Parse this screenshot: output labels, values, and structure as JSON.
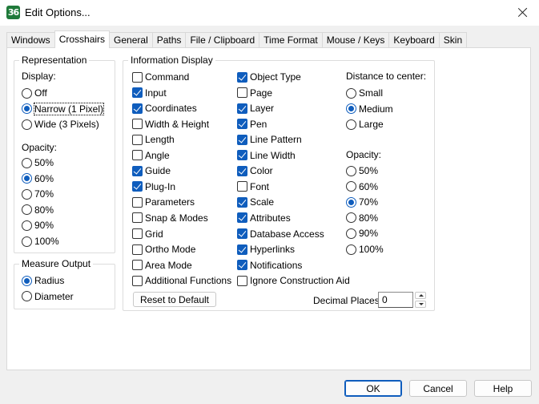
{
  "window": {
    "app_icon_text": "36",
    "title": "Edit Options..."
  },
  "tabs": [
    "Windows",
    "Crosshairs",
    "General",
    "Paths",
    "File / Clipboard",
    "Time Format",
    "Mouse / Keys",
    "Keyboard",
    "Skin"
  ],
  "active_tab": "Crosshairs",
  "representation": {
    "legend": "Representation",
    "display_label": "Display:",
    "display_options": [
      {
        "label": "Off",
        "selected": false
      },
      {
        "label": "Narrow (1 Pixel)",
        "selected": true
      },
      {
        "label": "Wide (3 Pixels)",
        "selected": false
      }
    ],
    "opacity_label": "Opacity:",
    "opacity_options": [
      {
        "label": "50%",
        "selected": false
      },
      {
        "label": "60%",
        "selected": true
      },
      {
        "label": "70%",
        "selected": false
      },
      {
        "label": "80%",
        "selected": false
      },
      {
        "label": "90%",
        "selected": false
      },
      {
        "label": "100%",
        "selected": false
      }
    ]
  },
  "measure_output": {
    "legend": "Measure Output",
    "options": [
      {
        "label": "Radius",
        "selected": true
      },
      {
        "label": "Diameter",
        "selected": false
      }
    ]
  },
  "information_display": {
    "legend": "Information Display",
    "column1": [
      {
        "label": "Command",
        "checked": false
      },
      {
        "label": "Input",
        "checked": true
      },
      {
        "label": "Coordinates",
        "checked": true
      },
      {
        "label": "Width & Height",
        "checked": false
      },
      {
        "label": "Length",
        "checked": false
      },
      {
        "label": "Angle",
        "checked": false
      },
      {
        "label": "Guide",
        "checked": true
      },
      {
        "label": "Plug-In",
        "checked": true
      },
      {
        "label": "Parameters",
        "checked": false
      },
      {
        "label": "Snap & Modes",
        "checked": false
      },
      {
        "label": "Grid",
        "checked": false
      },
      {
        "label": "Ortho Mode",
        "checked": false
      },
      {
        "label": "Area Mode",
        "checked": false
      },
      {
        "label": "Additional Functions",
        "checked": false
      }
    ],
    "column2": [
      {
        "label": "Object Type",
        "checked": true
      },
      {
        "label": "Page",
        "checked": false
      },
      {
        "label": "Layer",
        "checked": true
      },
      {
        "label": "Pen",
        "checked": true
      },
      {
        "label": "Line Pattern",
        "checked": true
      },
      {
        "label": "Line Width",
        "checked": true
      },
      {
        "label": "Color",
        "checked": true
      },
      {
        "label": "Font",
        "checked": false
      },
      {
        "label": "Scale",
        "checked": true
      },
      {
        "label": "Attributes",
        "checked": true
      },
      {
        "label": "Database Access",
        "checked": true
      },
      {
        "label": "Hyperlinks",
        "checked": true
      },
      {
        "label": "Notifications",
        "checked": true
      },
      {
        "label": "Ignore Construction Aid",
        "checked": false
      }
    ],
    "distance_label": "Distance to center:",
    "distance_options": [
      {
        "label": "Small",
        "selected": false
      },
      {
        "label": "Medium",
        "selected": true
      },
      {
        "label": "Large",
        "selected": false
      }
    ],
    "opacity_label": "Opacity:",
    "opacity_options": [
      {
        "label": "50%",
        "selected": false
      },
      {
        "label": "60%",
        "selected": false
      },
      {
        "label": "70%",
        "selected": true
      },
      {
        "label": "80%",
        "selected": false
      },
      {
        "label": "90%",
        "selected": false
      },
      {
        "label": "100%",
        "selected": false
      }
    ],
    "reset_label": "Reset to Default",
    "decimal_label": "Decimal Places:",
    "decimal_value": "0"
  },
  "footer": {
    "ok_label": "OK",
    "cancel_label": "Cancel",
    "help_label": "Help"
  },
  "colors": {
    "accent": "#0f5dbd",
    "app_icon": "#1f7a3a"
  }
}
